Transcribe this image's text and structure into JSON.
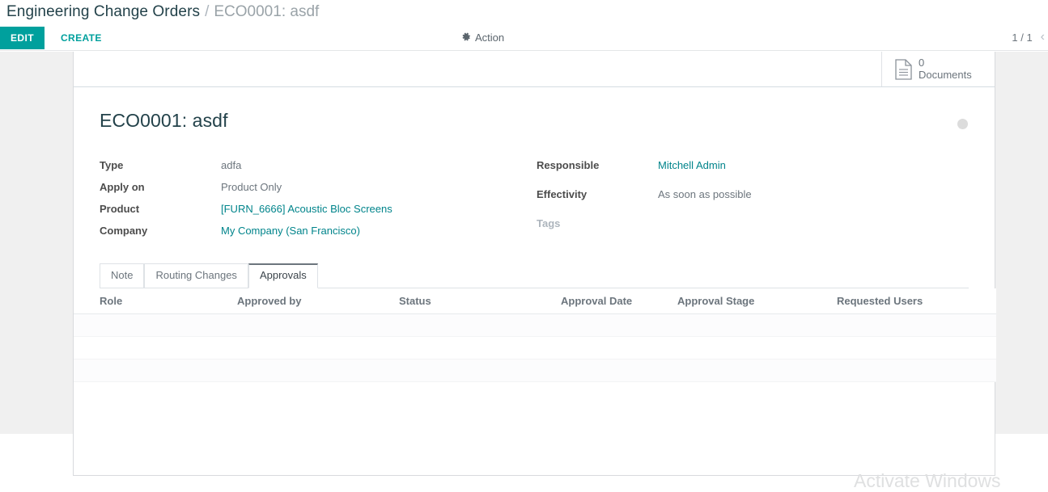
{
  "breadcrumb": {
    "root": "Engineering Change Orders",
    "separator": "/",
    "current": "ECO0001: asdf"
  },
  "control_panel": {
    "edit_label": "EDIT",
    "create_label": "CREATE",
    "action_label": "Action",
    "action_icon": "gear-icon",
    "pager": "1 / 1",
    "pager_prev_icon": "chevron-left-icon"
  },
  "stat_buttons": [
    {
      "icon": "document-icon",
      "value": "0",
      "label": "Documents"
    }
  ],
  "record": {
    "title": "ECO0001: asdf",
    "status_indicator": "activity-dot"
  },
  "fields": {
    "left": [
      {
        "label": "Type",
        "value": "adfa",
        "is_link": false,
        "label_muted": false
      },
      {
        "label": "Apply on",
        "value": "Product Only",
        "is_link": false,
        "label_muted": false
      },
      {
        "label": "Product",
        "value": "[FURN_6666] Acoustic Bloc Screens",
        "is_link": true,
        "label_muted": false
      },
      {
        "label": "Company",
        "value": "My Company (San Francisco)",
        "is_link": true,
        "label_muted": false
      }
    ],
    "right": [
      {
        "label": "Responsible",
        "value": "Mitchell Admin",
        "is_link": true,
        "label_muted": false
      },
      {
        "label": "Effectivity",
        "value": "As soon as possible",
        "is_link": false,
        "label_muted": false
      },
      {
        "label": "Tags",
        "value": "",
        "is_link": false,
        "label_muted": true
      }
    ]
  },
  "notebook": {
    "tabs": [
      {
        "label": "Note",
        "active": false
      },
      {
        "label": "Routing Changes",
        "active": false
      },
      {
        "label": "Approvals",
        "active": true
      }
    ]
  },
  "approvals_table": {
    "columns": [
      "Role",
      "Approved by",
      "Status",
      "Approval Date",
      "Approval Stage",
      "Requested Users"
    ],
    "rows": []
  },
  "watermark": {
    "text": "Activate Windows"
  },
  "colors": {
    "accent": "#00a09d",
    "link": "#00848b",
    "title": "#23424a",
    "muted": "#6c757d",
    "canvas": "#f0f0f0"
  }
}
